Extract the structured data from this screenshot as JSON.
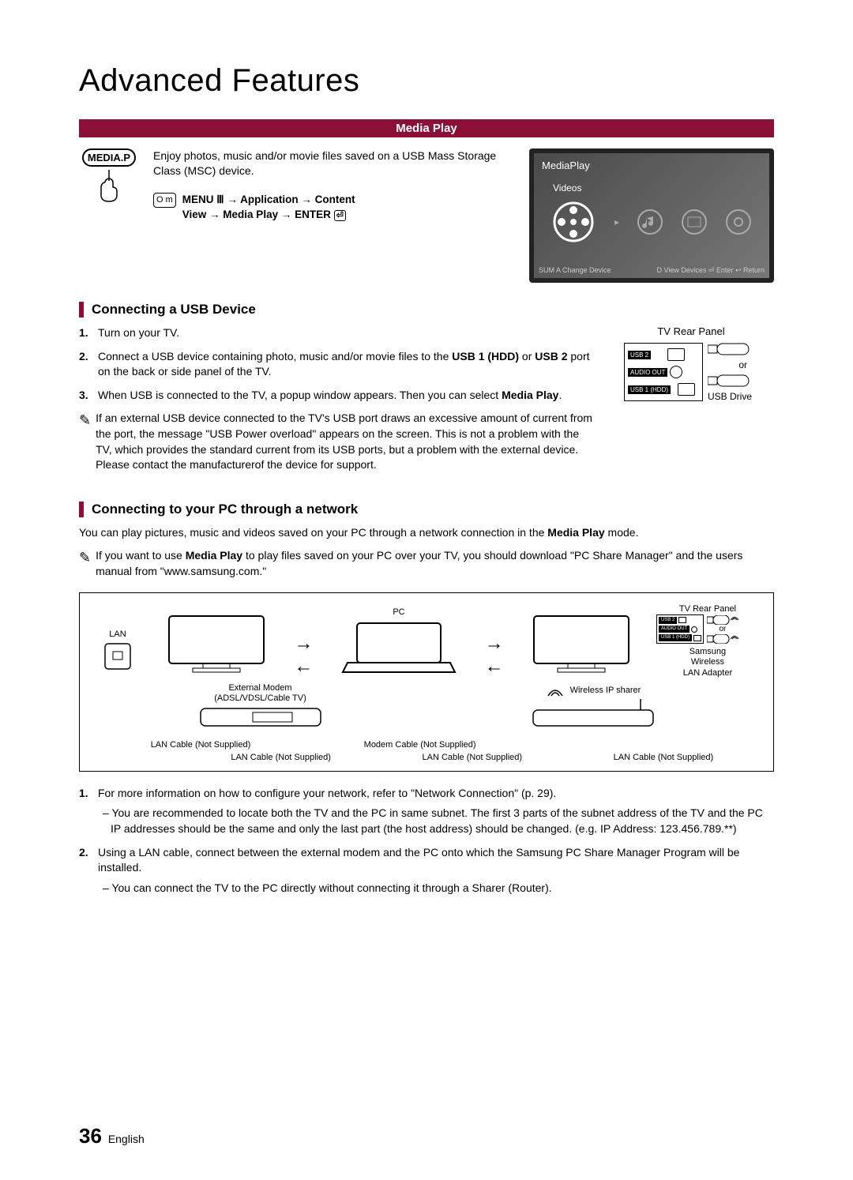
{
  "header": {
    "title": "Advanced Features",
    "section_bar": "Media Play"
  },
  "intro": {
    "button_label": "MEDIA.P",
    "description": "Enjoy photos, music and/or movie files saved on a USB Mass Storage Class (MSC) device.",
    "menu_icon": "O m",
    "nav_line1": "MENU Ⅲ → Application → Content",
    "nav_line2": "View → Media Play → ENTER",
    "enter_glyph": "⏎"
  },
  "screenshot": {
    "title": "MediaPlay",
    "category": "Videos",
    "foot_left": "SUM  A Change Device",
    "foot_right": "D View Devices   ⏎ Enter   ↩ Return"
  },
  "usb_section": {
    "heading": "Connecting a USB Device",
    "steps": [
      {
        "pre": "Turn on your TV.",
        "bold": "",
        "post": ""
      },
      {
        "pre": "Connect a USB device containing photo, music and/or movie files to the ",
        "bold1": "USB 1 (HDD)",
        "mid": " or ",
        "bold2": "USB 2",
        "post": " port on the back or side panel of the TV."
      },
      {
        "pre": "When USB is connected to the TV, a popup window appears. Then you can select ",
        "bold": "Media Play",
        "post": "."
      }
    ],
    "note": "If an external USB device connected to the TV's USB port draws an excessive amount of current from the port, the message \"USB Power overload\" appears on the screen. This is not a problem with the TV, which provides the standard current from its USB ports, but a problem with the external device. Please contact the manufacturerof the device for support.",
    "rear_panel_label": "TV Rear Panel",
    "ports": {
      "usb2": "USB 2",
      "audio": "AUDIO OUT",
      "usb1": "USB 1 (HDD)"
    },
    "or": "or",
    "usb_drive": "USB Drive"
  },
  "pc_section": {
    "heading": "Connecting to your PC through a network",
    "intro_pre": "You can play pictures, music and videos saved on your PC through a network connection in the ",
    "intro_bold": "Media Play",
    "intro_post": " mode.",
    "note_pre": "If you want to use ",
    "note_bold": "Media Play",
    "note_post": " to play files saved on your PC over your TV, you should download \"PC Share Manager\" and the users manual from \"www.samsung.com.\"",
    "diagram": {
      "lan": "LAN",
      "pc": "PC",
      "rear_panel": "TV Rear Panel",
      "ports": {
        "usb2": "USB 2",
        "audio": "AUDIO OUT",
        "usb1": "USB 1 (HDD)"
      },
      "or": "or",
      "adapter1": "Samsung",
      "adapter2": "Wireless",
      "adapter3": "LAN Adapter",
      "modem1": "External Modem",
      "modem2": "(ADSL/VDSL/Cable TV)",
      "sharer": "Wireless IP sharer",
      "cable_lan": "LAN Cable (Not Supplied)",
      "cable_modem": "Modem Cable (Not Supplied)"
    },
    "steps": [
      {
        "text": "For more information on how to configure your network, refer to \"Network Connection\" (p. 29).",
        "sub": "You are recommended to locate both the TV and the PC in same subnet. The first 3 parts of the subnet address of the TV and the PC IP addresses should be the same and only the last part (the host address) should be changed. (e.g. IP Address: 123.456.789.**)"
      },
      {
        "text": "Using a LAN cable, connect between the external modem and the PC onto which the Samsung PC Share Manager Program will be installed.",
        "sub": "You can connect the TV to the PC directly without connecting it through a Sharer (Router)."
      }
    ]
  },
  "footer": {
    "page_number": "36",
    "language": "English"
  }
}
